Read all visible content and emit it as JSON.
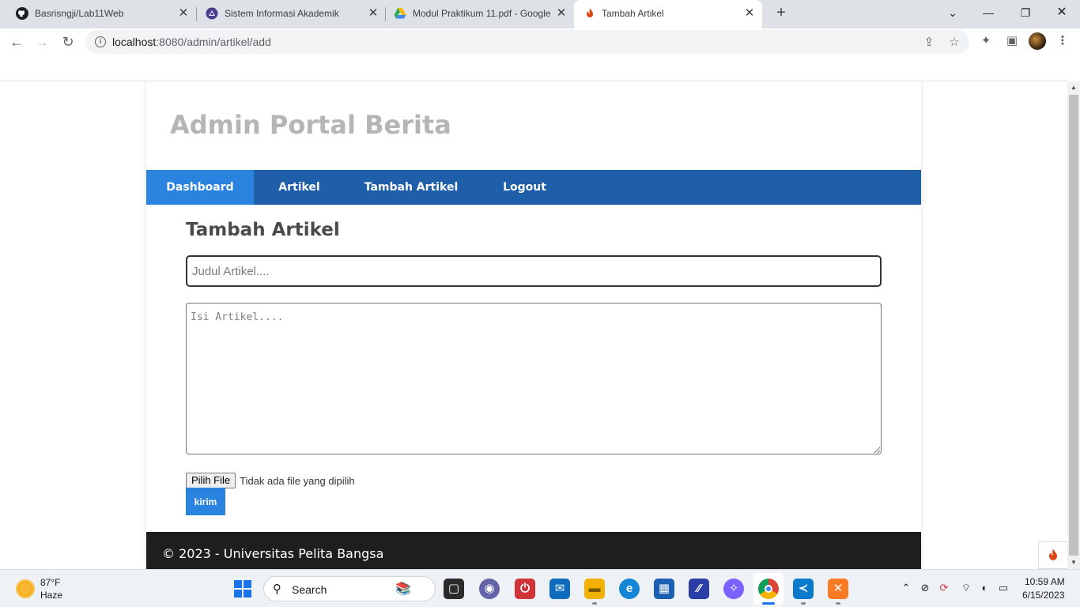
{
  "browser": {
    "tabs": [
      {
        "title": "Basrisngji/Lab11Web",
        "icon": "github-icon"
      },
      {
        "title": "Sistem Informasi Akademik",
        "icon": "university-logo-icon"
      },
      {
        "title": "Modul Praktikum 11.pdf - Google",
        "icon": "google-drive-icon"
      },
      {
        "title": "Tambah Artikel",
        "icon": "codeigniter-flame-icon",
        "active": true
      }
    ],
    "close_glyph": "✕",
    "new_tab_glyph": "+",
    "url_host": "localhost",
    "url_path": ":8080/admin/artikel/add"
  },
  "page": {
    "site_title": "Admin Portal Berita",
    "nav": [
      {
        "label": "Dashboard",
        "active": true
      },
      {
        "label": "Artikel"
      },
      {
        "label": "Tambah Artikel"
      },
      {
        "label": "Logout"
      }
    ],
    "heading": "Tambah Artikel",
    "form": {
      "title_placeholder": "Judul Artikel....",
      "body_placeholder": "Isi Artikel....",
      "file_button": "Pilih File",
      "file_status": "Tidak ada file yang dipilih",
      "submit_label": "kirim"
    },
    "footer": "© 2023 - Universitas Pelita Bangsa"
  },
  "taskbar": {
    "weather_temp": "87°F",
    "weather_desc": "Haze",
    "search_label": "Search",
    "clock_time": "10:59 AM",
    "clock_date": "6/15/2023"
  },
  "colors": {
    "nav_bar": "#1f5faa",
    "nav_active": "#2b83e0",
    "footer": "#1e1e1e",
    "site_title": "#b5b5b5"
  }
}
